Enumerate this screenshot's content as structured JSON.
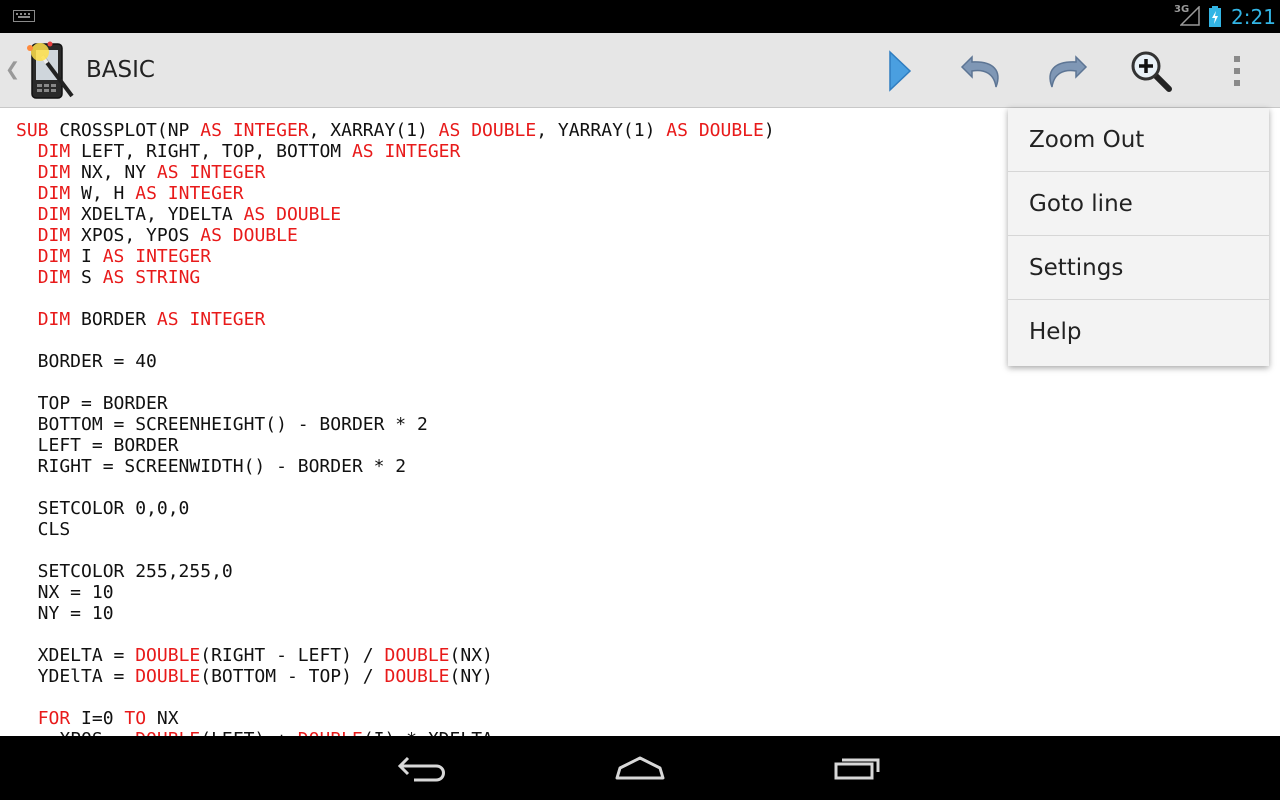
{
  "status_bar": {
    "network_type": "3G",
    "time": "2:21",
    "icons": [
      "keyboard-icon",
      "signal-icon",
      "battery-charging-icon"
    ]
  },
  "action_bar": {
    "title": "BASIC",
    "icons": [
      "app-logo-icon",
      "play-icon",
      "undo-icon",
      "redo-icon",
      "zoom-in-icon",
      "overflow-menu-icon"
    ]
  },
  "overflow_menu": {
    "items": [
      "Zoom Out",
      "Goto line",
      "Settings",
      "Help"
    ]
  },
  "editor": {
    "keywords": [
      "SUB",
      "DIM",
      "AS",
      "INTEGER",
      "DOUBLE",
      "STRING",
      "FOR",
      "TO"
    ],
    "lines": [
      "SUB CROSSPLOT(NP AS INTEGER, XARRAY(1) AS DOUBLE, YARRAY(1) AS DOUBLE)",
      "  DIM LEFT, RIGHT, TOP, BOTTOM AS INTEGER",
      "  DIM NX, NY AS INTEGER",
      "  DIM W, H AS INTEGER",
      "  DIM XDELTA, YDELTA AS DOUBLE",
      "  DIM XPOS, YPOS AS DOUBLE",
      "  DIM I AS INTEGER",
      "  DIM S AS STRING",
      "",
      "  DIM BORDER AS INTEGER",
      "",
      "  BORDER = 40",
      "",
      "  TOP = BORDER",
      "  BOTTOM = SCREENHEIGHT() - BORDER * 2",
      "  LEFT = BORDER",
      "  RIGHT = SCREENWIDTH() - BORDER * 2",
      "",
      "  SETCOLOR 0,0,0",
      "  CLS",
      "",
      "  SETCOLOR 255,255,0",
      "  NX = 10",
      "  NY = 10",
      "",
      "  XDELTA = DOUBLE(RIGHT - LEFT) / DOUBLE(NX)",
      "  YDElTA = DOUBLE(BOTTOM - TOP) / DOUBLE(NY)",
      "",
      "  FOR I=0 TO NX",
      "    XPOS = DOUBLE(LEFT) + DOUBLE(I) * XDELTA"
    ]
  },
  "nav_bar": {
    "icons": [
      "back-icon",
      "home-icon",
      "recents-icon"
    ]
  },
  "colors": {
    "keyword": "#e81a1a",
    "clock": "#33b5e5",
    "action_bar_bg": "#e6e6e6"
  }
}
